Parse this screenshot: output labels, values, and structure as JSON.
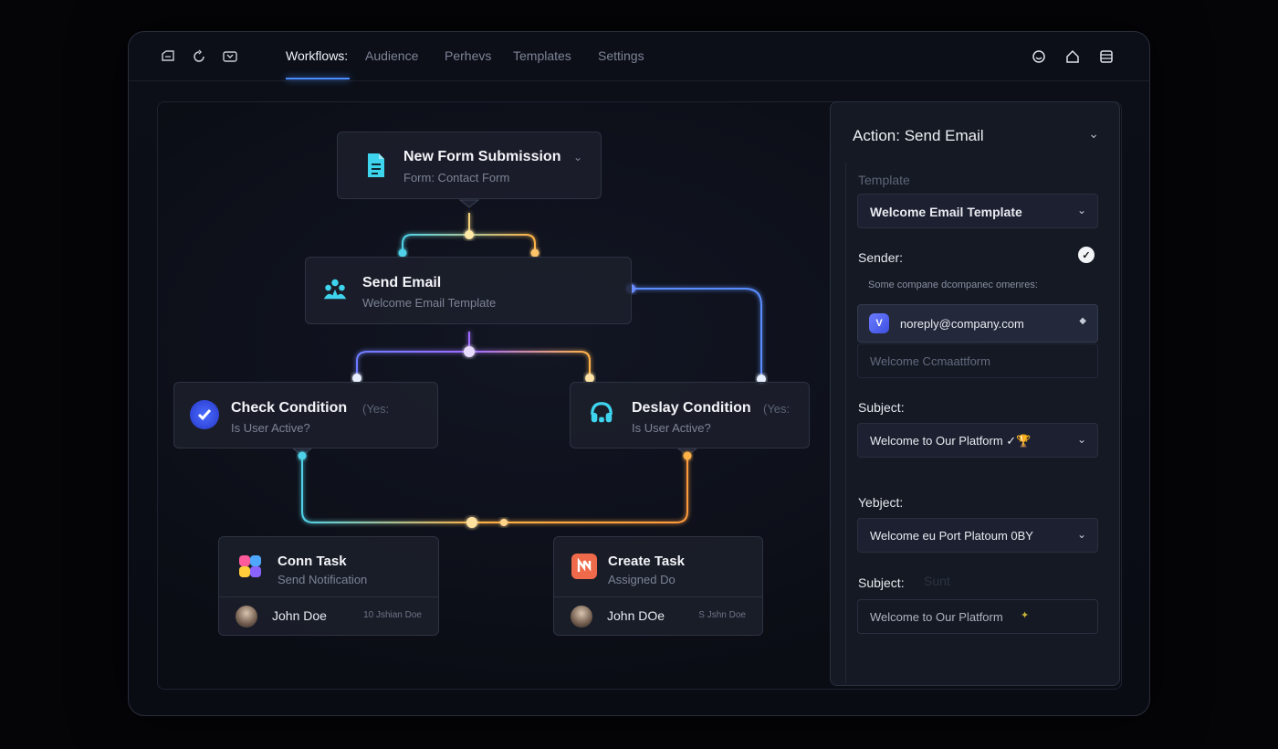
{
  "topbar": {
    "left_icons": [
      "document-icon",
      "refresh-icon",
      "gamepad-icon"
    ],
    "tabs": [
      "Workflows:",
      "Audience",
      "Perhevs",
      "Templates",
      "Settings"
    ],
    "right_icons": [
      "smiley-icon",
      "home-icon",
      "list-icon"
    ]
  },
  "nodes": {
    "trigger": {
      "title": "New Form Submission",
      "sub": "Form: Contact Form"
    },
    "send_email": {
      "title": "Send Email",
      "sub": "Welcome Email Template"
    },
    "check_condition": {
      "title": "Check Condition",
      "extra": "(Yes:",
      "sub": "Is User Active?"
    },
    "delay_condition": {
      "title": "Deslay Condition",
      "extra": "(Yes:",
      "sub": "Is User Active?"
    },
    "conn_task": {
      "title": "Conn Task",
      "sub": "Send Notification",
      "user": "John Doe",
      "user_extra": "10 Jshian Doe"
    },
    "create_task": {
      "title": "Create Task",
      "sub": "Assigned Do",
      "user": "John DOe",
      "user_extra": "S Jshn Doe"
    }
  },
  "panel": {
    "title": "Action: Send Email",
    "template_label": "Template",
    "template_value": "Welcome Email Template",
    "sender_label": "Sender:",
    "sender_hint": "Some compane dcompanec omenres:",
    "sender_value": "noreply@company.com",
    "sender_badge": "V",
    "placeholder_row": "Welcome Ccmaattform",
    "subject_label": "Subject:",
    "subject_value": "Welcome to Our Platform ✓🏆",
    "subject2_label": "Yebject:",
    "subject2_value": "Welcome eu Port Platoum 0BY",
    "subject3_label": "Subject:",
    "subject3_ghost": "Sunt",
    "subject3_value": "Welcome to Our Platform"
  },
  "colors": {
    "accent_blue": "#4b8cff",
    "wire_cyan": "#4fd2e8",
    "wire_orange": "#ffb347",
    "wire_purple": "#8a63ff"
  }
}
